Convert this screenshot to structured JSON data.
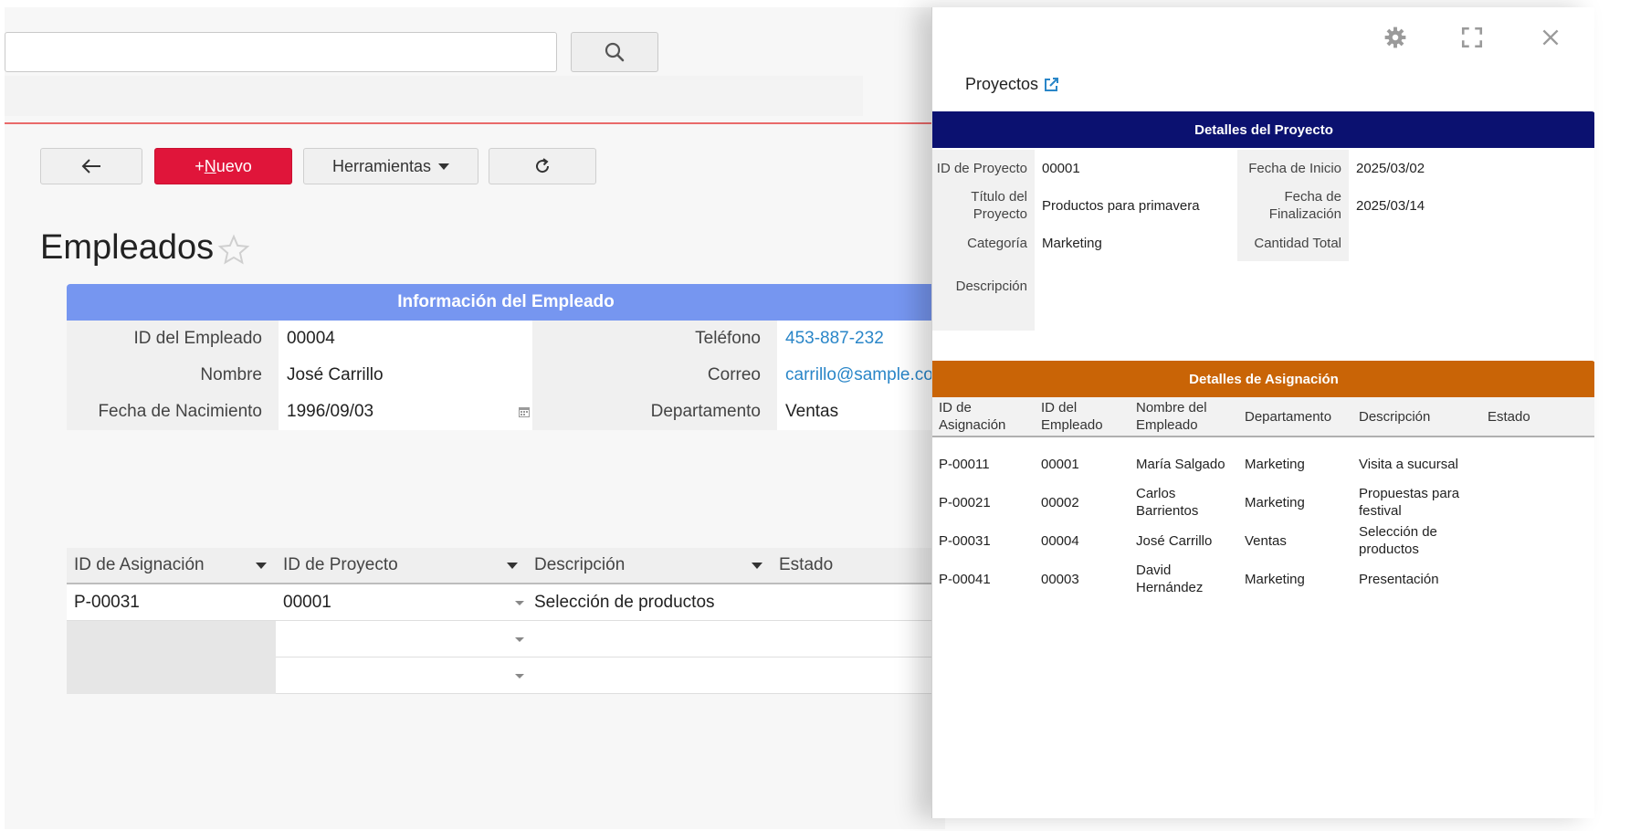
{
  "main": {
    "toolbar": {
      "new_label_prefix": "+",
      "new_label_underlined": "N",
      "new_label_rest": "uevo",
      "tools_label": "Herramientas"
    },
    "page_title": "Empleados",
    "employee_section": {
      "header": "Información del Empleado",
      "fields": {
        "id_label": "ID del Empleado",
        "id_value": "00004",
        "name_label": "Nombre",
        "name_value": "José Carrillo",
        "birth_label": "Fecha de Nacimiento",
        "birth_value": "1996/09/03",
        "phone_label": "Teléfono",
        "phone_value": "453-887-232",
        "email_label": "Correo",
        "email_value": "carrillo@sample.co",
        "dept_label": "Departamento",
        "dept_value": "Ventas"
      }
    },
    "assignments_grid": {
      "columns": [
        "ID de Asignación",
        "ID de Proyecto",
        "Descripción",
        "Estado"
      ],
      "rows": [
        {
          "assignment_id": "P-00031",
          "project_id": "00001",
          "description": "Selección de productos",
          "status": ""
        }
      ]
    }
  },
  "panel": {
    "title": "Proyectos",
    "project_section": {
      "header": "Detalles del Proyecto",
      "id_label": "ID de Proyecto",
      "id_value": "00001",
      "title_label": "Título del Proyecto",
      "title_value": "Productos para primavera",
      "category_label": "Categoría",
      "category_value": "Marketing",
      "description_label": "Descripción",
      "description_value": "",
      "start_label": "Fecha de Inicio",
      "start_value": "2025/03/02",
      "end_label": "Fecha de Finalización",
      "end_value": "2025/03/14",
      "total_label": "Cantidad Total",
      "total_value": ""
    },
    "assignment_section": {
      "header": "Detalles de Asignación",
      "columns": [
        "ID de Asignación",
        "ID del Empleado",
        "Nombre del Empleado",
        "Departamento",
        "Descripción",
        "Estado"
      ],
      "rows": [
        {
          "id": "P-00011",
          "emp_id": "00001",
          "name": "María Salgado",
          "dept": "Marketing",
          "desc": "Visita a sucursal",
          "status": ""
        },
        {
          "id": "P-00021",
          "emp_id": "00002",
          "name": "Carlos Barrientos",
          "dept": "Marketing",
          "desc": "Propuestas para festival",
          "status": ""
        },
        {
          "id": "P-00031",
          "emp_id": "00004",
          "name": "José Carrillo",
          "dept": "Ventas",
          "desc": "Selección de productos",
          "status": ""
        },
        {
          "id": "P-00041",
          "emp_id": "00003",
          "name": "David Hernández",
          "dept": "Marketing",
          "desc": "Presentación",
          "status": ""
        }
      ]
    }
  },
  "colors": {
    "accent_red": "#e0153a",
    "employee_header": "#7696f0",
    "project_header": "#0b1170",
    "assignment_header": "#c96406",
    "link": "#2a86c8"
  }
}
